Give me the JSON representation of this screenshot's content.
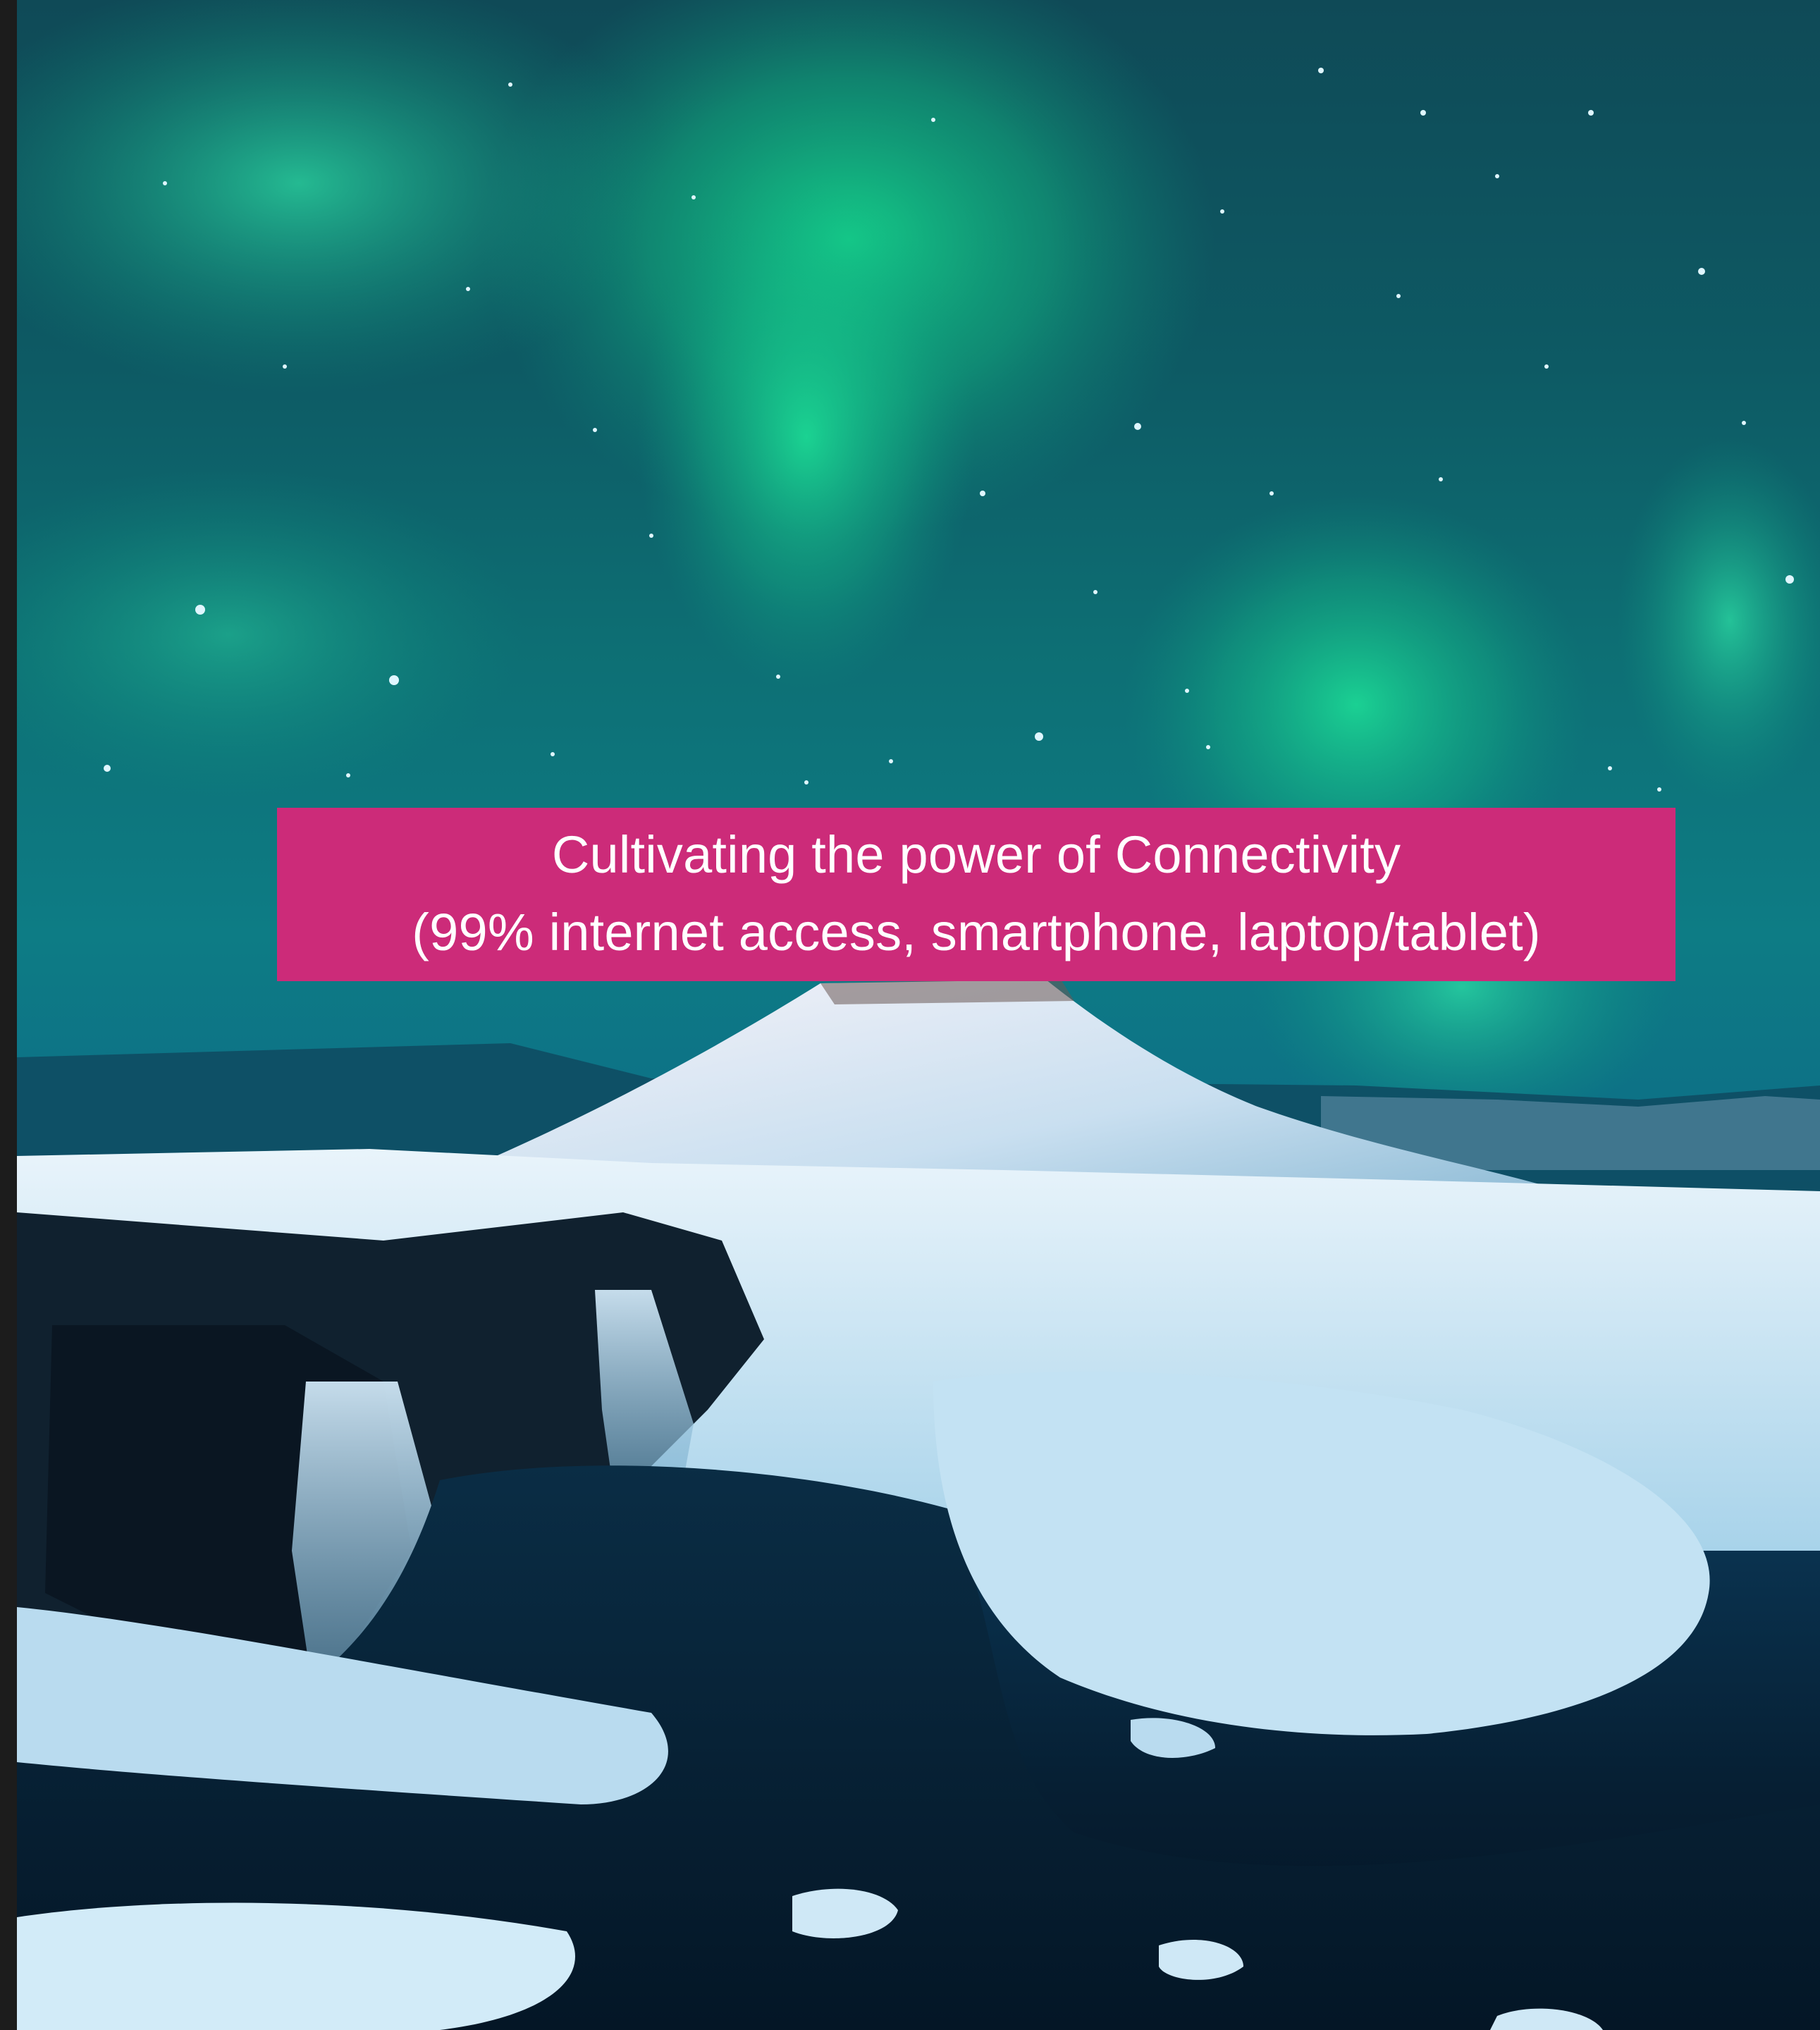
{
  "caption": {
    "line1": "Cultivating the power of Connectivity",
    "line2": "(99% internet access, smartphone, laptop/tablet)",
    "background_color": "#cc2b79",
    "text_color": "#ffffff"
  },
  "photo": {
    "subject": "aurora-over-snowy-mountain-and-waterfall"
  }
}
